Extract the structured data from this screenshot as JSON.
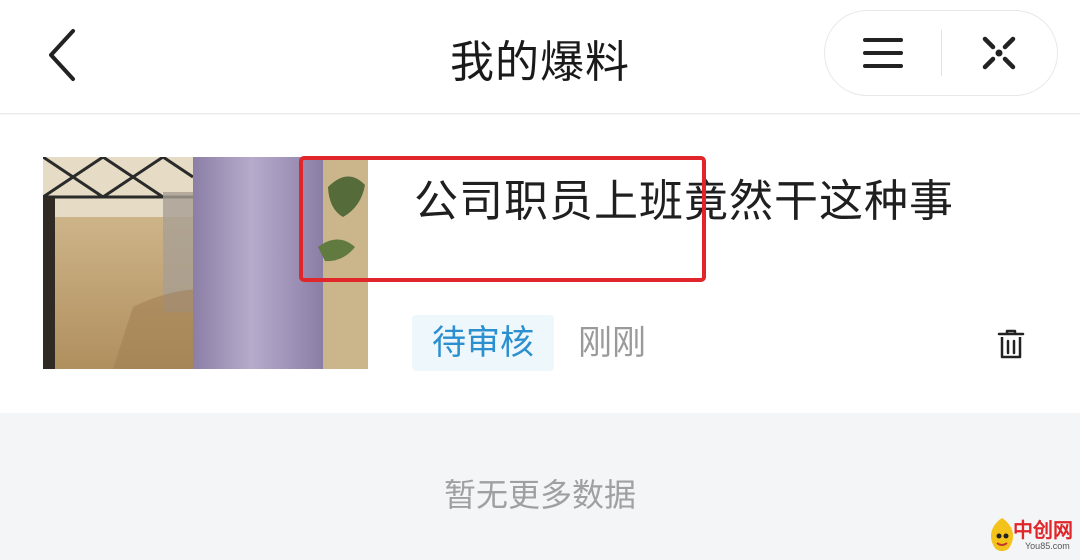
{
  "header": {
    "title": "我的爆料",
    "back_icon": "chevron-left-icon",
    "menu_icon": "menu-icon",
    "close_icon": "close-capsule-icon"
  },
  "item": {
    "title": "公司职员上班竟然干这种事",
    "status": "待审核",
    "time": "刚刚",
    "delete_icon": "trash-icon",
    "thumbnail": "photo-thumbnail"
  },
  "footer": {
    "no_more": "暂无更多数据"
  },
  "watermark": {
    "text": "中创网",
    "sub": "You85.com"
  },
  "colors": {
    "status_text": "#2b8fd0",
    "status_bg": "#eef7fc",
    "highlight": "#e0262a",
    "background": "#f4f5f7"
  }
}
